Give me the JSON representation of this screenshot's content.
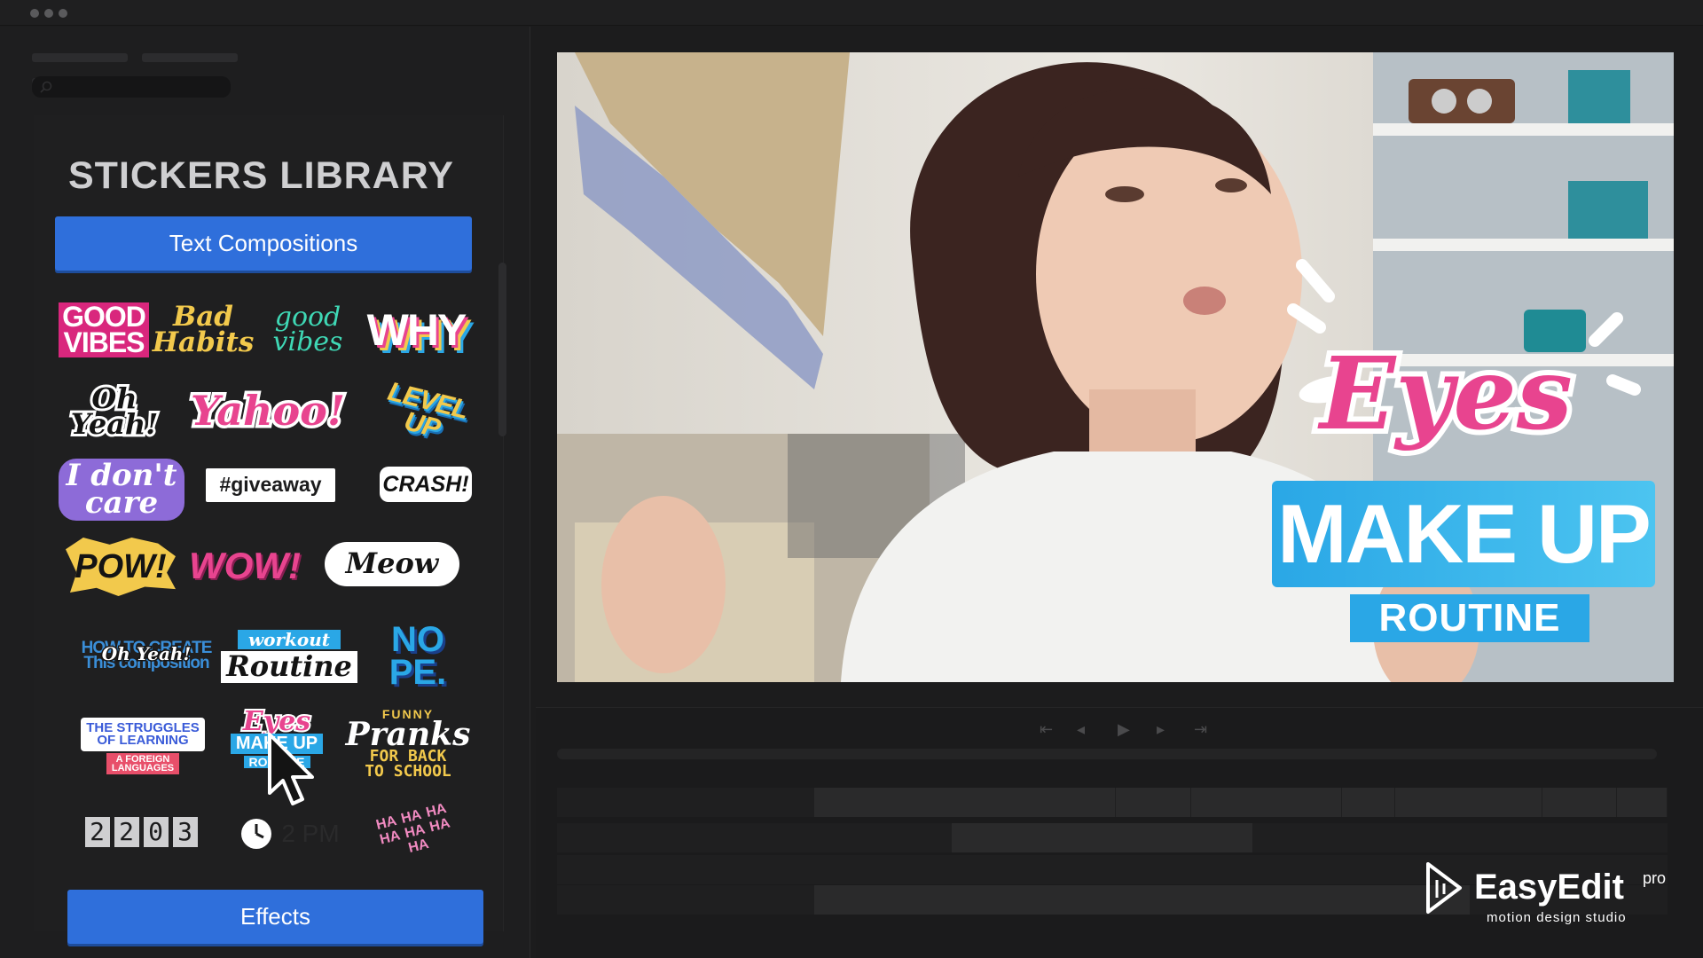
{
  "library": {
    "title": "STICKERS LIBRARY",
    "category_label": "Text Compositions",
    "effects_label": "Effects"
  },
  "stickers": {
    "good_vibes": "GOOD\nVIBES",
    "bad_habits": "Bad\nHabits",
    "good_vibes_script": "good\nvibes",
    "why": "WHY",
    "oh_yeah": "Oh Yeah!",
    "yahoo": "Yahoo!",
    "level_up": "LEVEL UP",
    "i_dont_care": "I don't\ncare",
    "giveaway": "#giveaway",
    "crash": "CRASH!",
    "pow": "POW!",
    "wow": "WOW!",
    "meow": "Meow",
    "how_to_create": "HOW TO CREATE\nThis composition",
    "oh_yeah_overlay": "Oh Yeah!",
    "workout": "workout",
    "routine": "Routine",
    "nope": "NO\nPE.",
    "struggles": "THE STRUGGLES\nOF LEARNING",
    "foreign": "A FOREIGN\nLANGUAGES",
    "eyes_small": "Eyes",
    "makeup_small": "MAKE UP",
    "routine_small": "ROUTINE",
    "funny": "FUNNY",
    "pranks": "Pranks",
    "back_to_school": "FOR BACK\nTO SCHOOL",
    "counter_digits": [
      "2",
      "2",
      "0",
      "3"
    ],
    "clock_time": "2 PM",
    "haha": "HA HA HA HA HA HA HA"
  },
  "video_overlay": {
    "eyes": "Eyes",
    "make_up": "MAKE UP",
    "routine": "ROUTINE"
  },
  "brand": {
    "name": "EasyEdit",
    "suffix": "pro",
    "tagline": "motion design studio"
  },
  "colors": {
    "accent_blue": "#2f6fdb",
    "pink": "#e8448f",
    "cyan": "#2aa7e6"
  }
}
